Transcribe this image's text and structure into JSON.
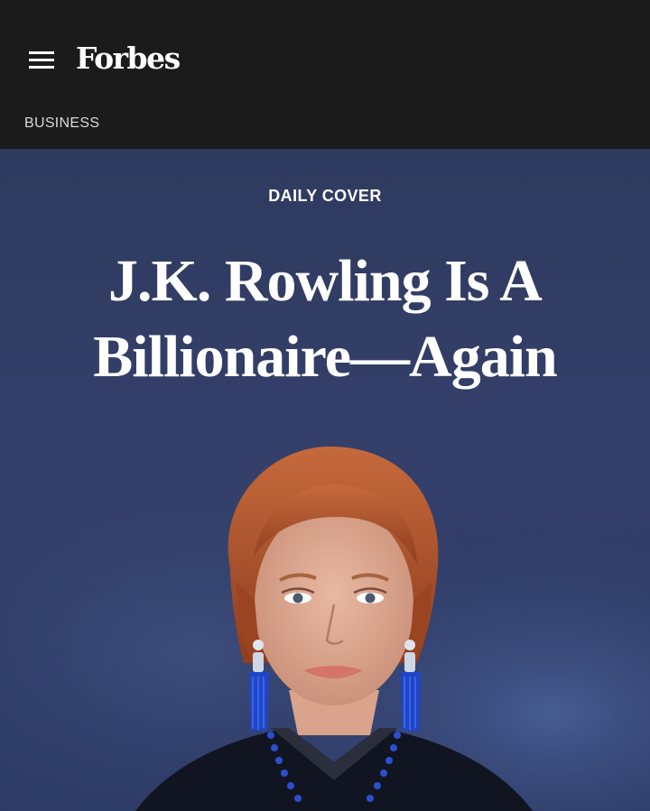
{
  "header": {
    "menu_icon": "hamburger-menu-icon",
    "logo_text": "Forbes",
    "section_label": "BUSINESS"
  },
  "article": {
    "kicker": "DAILY COVER",
    "headline": "J.K. Rowling Is A Billionaire—Again"
  },
  "photo": {
    "subject": "portrait-photo",
    "background_color": "#2f3a5f",
    "hair_color": "#b5562e",
    "earring_color": "#1f46c8"
  },
  "colors": {
    "header_bg": "#1b1b1b",
    "hero_bg": "#2f3a5f",
    "text": "#ffffff"
  }
}
